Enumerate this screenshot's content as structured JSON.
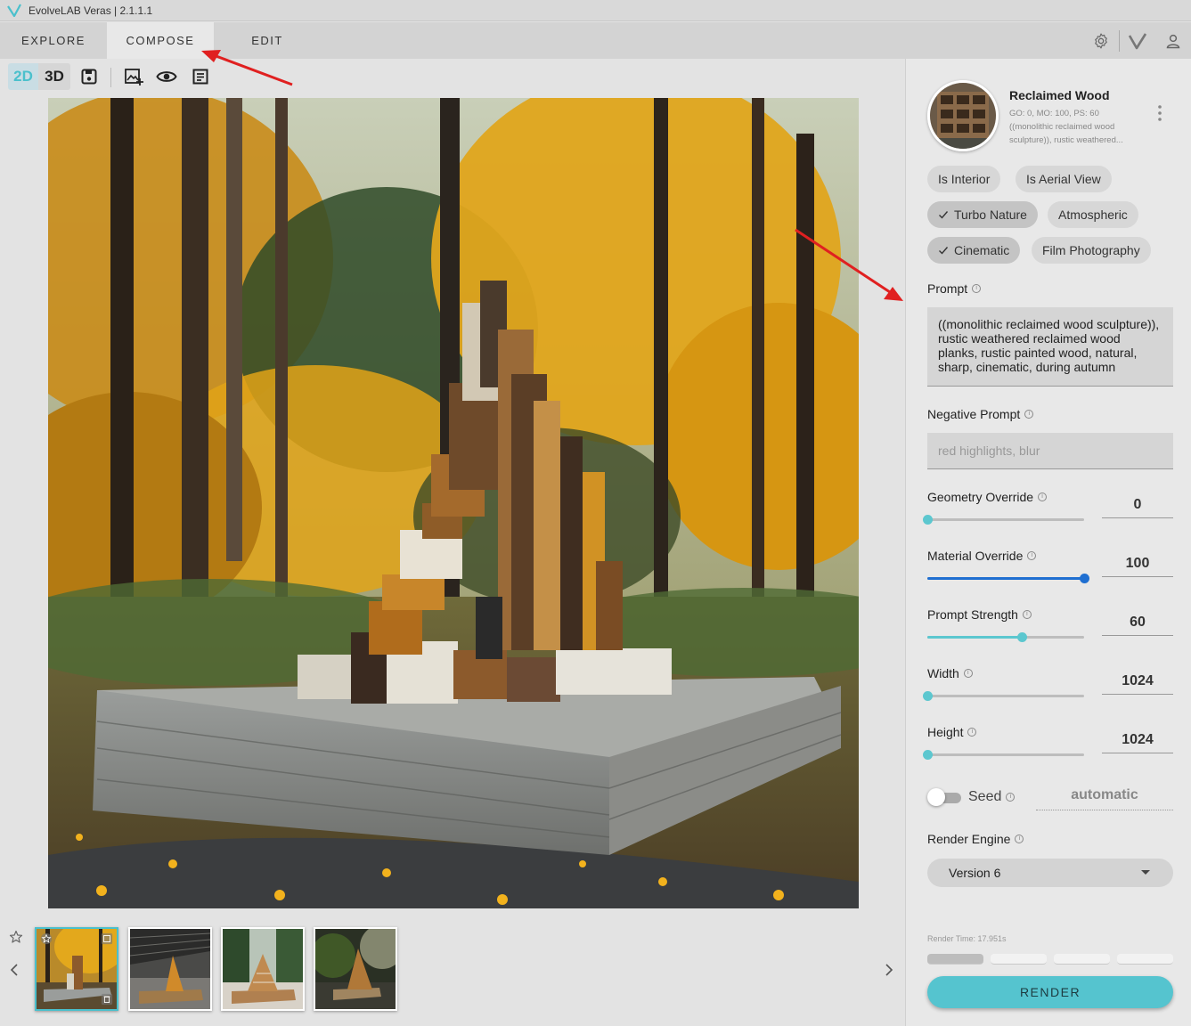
{
  "app": {
    "title": "EvolveLAB Veras | 2.1.1.1"
  },
  "tabs": [
    {
      "label": "EXPLORE",
      "active": false
    },
    {
      "label": "COMPOSE",
      "active": true
    },
    {
      "label": "EDIT",
      "active": false
    }
  ],
  "header_icons": [
    "gear-icon",
    "veras-logo-icon",
    "user-icon"
  ],
  "toolbar": {
    "mode_2d": "2D",
    "mode_3d": "3D",
    "active_mode": "2D",
    "icons": [
      "save-icon",
      "add-image-icon",
      "eye-icon",
      "list-icon"
    ]
  },
  "thumbnails": {
    "count": 4,
    "selected_index": 0
  },
  "preset": {
    "name": "Reclaimed Wood",
    "meta_line1": "GO: 0, MO: 100, PS: 60",
    "meta_line2": "((monolithic reclaimed wood",
    "meta_line3": "sculpture)), rustic weathered..."
  },
  "chips": [
    {
      "label": "Is Interior",
      "checked": false
    },
    {
      "label": "Is Aerial View",
      "checked": false
    },
    {
      "label": "Turbo Nature",
      "checked": true
    },
    {
      "label": "Atmospheric",
      "checked": false
    },
    {
      "label": "Cinematic",
      "checked": true
    },
    {
      "label": "Film Photography",
      "checked": false
    }
  ],
  "prompt": {
    "label": "Prompt",
    "value": "((monolithic reclaimed wood sculpture)), rustic weathered reclaimed wood planks, rustic painted wood, natural, sharp, cinematic, during autumn"
  },
  "negative_prompt": {
    "label": "Negative Prompt",
    "placeholder": "red highlights, blur"
  },
  "sliders": [
    {
      "label": "Geometry Override",
      "value": "0",
      "min": 0,
      "max": 100,
      "fraction": 0.0,
      "active": false
    },
    {
      "label": "Material Override",
      "value": "100",
      "min": 0,
      "max": 100,
      "fraction": 1.0,
      "active": true
    },
    {
      "label": "Prompt Strength",
      "value": "60",
      "min": 0,
      "max": 100,
      "fraction": 0.6,
      "active": false
    },
    {
      "label": "Width",
      "value": "1024",
      "fraction": 0.0,
      "active": false
    },
    {
      "label": "Height",
      "value": "1024",
      "fraction": 0.0,
      "active": false
    }
  ],
  "seed": {
    "label": "Seed",
    "value": "automatic",
    "enabled": false
  },
  "render_engine": {
    "label": "Render Engine",
    "value": "Version 6"
  },
  "render_time": "Render Time: 17.951s",
  "render_progress": {
    "completed": 1,
    "total": 4
  },
  "render_button": "RENDER",
  "colors": {
    "accent": "#4ac0cc",
    "slider_active": "#1f6fd1",
    "slider_inactive": "#5cc7cf",
    "annotation_arrow": "#e02020"
  }
}
